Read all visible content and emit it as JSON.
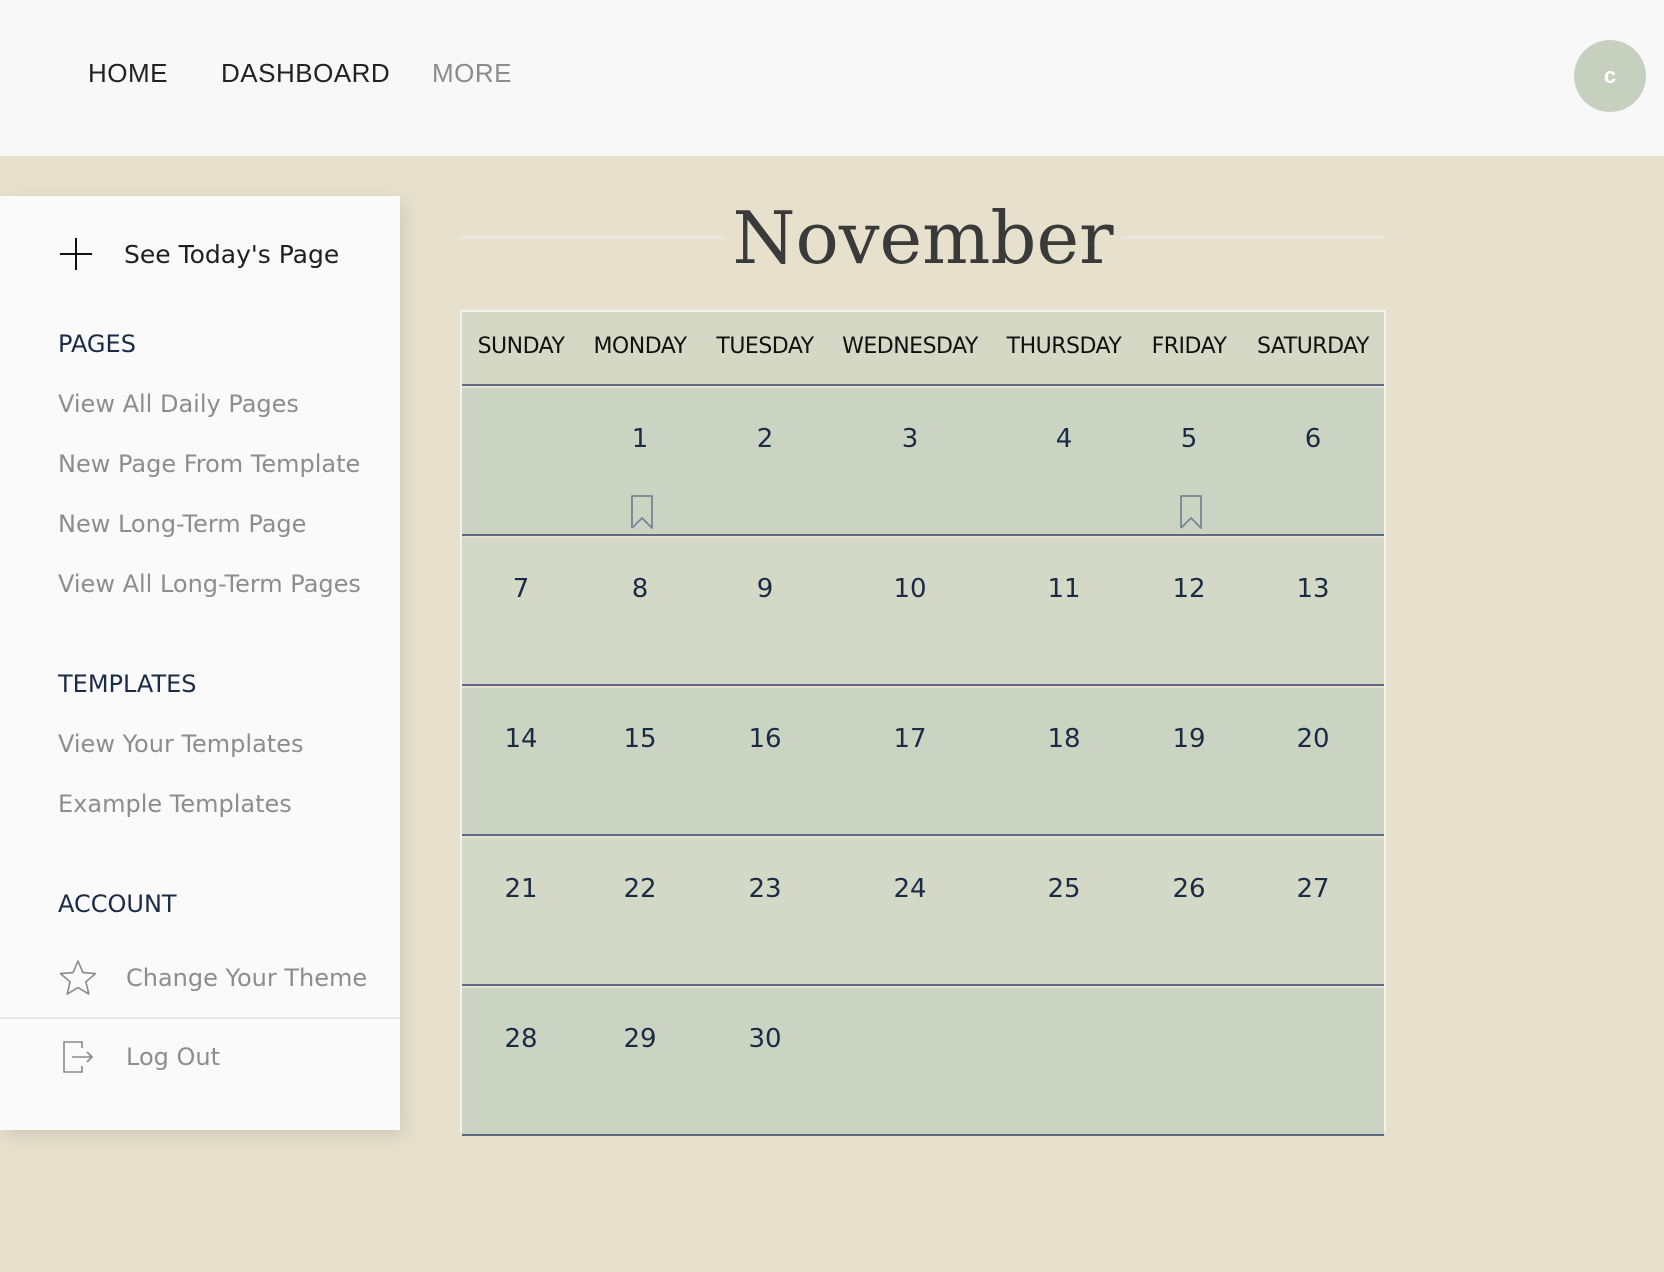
{
  "nav": {
    "home": "HOME",
    "dashboard": "DASHBOARD",
    "more": "MORE",
    "avatar_initial": "c"
  },
  "sidebar": {
    "today": "See Today's Page",
    "pages_heading": "PAGES",
    "pages_links": [
      "View All Daily Pages",
      "New Page From Template",
      "New Long-Term Page",
      "View All Long-Term Pages"
    ],
    "templates_heading": "TEMPLATES",
    "templates_links": [
      "View Your Templates",
      "Example Templates"
    ],
    "account_heading": "ACCOUNT",
    "theme": "Change Your Theme",
    "logout": "Log Out"
  },
  "calendar": {
    "month": "November",
    "weekdays": [
      "SUNDAY",
      "MONDAY",
      "TUESDAY",
      "WEDNESDAY",
      "THURSDAY",
      "FRIDAY",
      "SATURDAY"
    ],
    "weeks": [
      [
        "",
        "1",
        "2",
        "3",
        "4",
        "5",
        "6"
      ],
      [
        "7",
        "8",
        "9",
        "10",
        "11",
        "12",
        "13"
      ],
      [
        "14",
        "15",
        "16",
        "17",
        "18",
        "19",
        "20"
      ],
      [
        "21",
        "22",
        "23",
        "24",
        "25",
        "26",
        "27"
      ],
      [
        "28",
        "29",
        "30",
        "",
        "",
        "",
        ""
      ]
    ],
    "bookmarked_days": [
      "1",
      "5"
    ]
  },
  "colors": {
    "background": "#e6e0cc",
    "calendar_row_a": "#cbd4c2",
    "calendar_row_b": "#d4d8c6",
    "grid_line": "#5e6a85",
    "avatar": "#c6d0bf"
  }
}
